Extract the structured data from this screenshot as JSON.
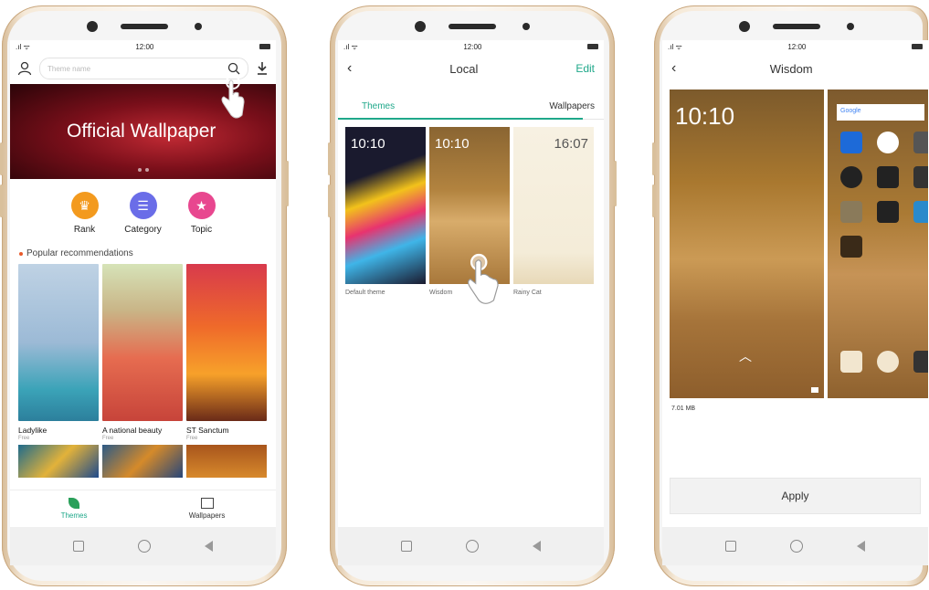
{
  "status": {
    "time": "12:00"
  },
  "screen1": {
    "search_placeholder": "Theme name",
    "banner_text": "Official Wallpaper",
    "categories": [
      {
        "label": "Rank",
        "icon": "crown-icon",
        "color": "#f39a1e"
      },
      {
        "label": "Category",
        "icon": "list-icon",
        "color": "#6a6de8"
      },
      {
        "label": "Topic",
        "icon": "star-icon",
        "color": "#e8478f"
      }
    ],
    "section_title": "Popular recommendations",
    "items": [
      {
        "name": "Ladylike",
        "price": "Free"
      },
      {
        "name": "A national beauty",
        "price": "Free"
      },
      {
        "name": "ST Sanctum",
        "price": "Free"
      }
    ],
    "tabs": [
      {
        "label": "Themes",
        "icon": "leaf-icon",
        "active": true
      },
      {
        "label": "Wallpapers",
        "icon": "image-icon",
        "active": false
      }
    ]
  },
  "screen2": {
    "title": "Local",
    "edit": "Edit",
    "tabs": [
      "Themes",
      "Wallpapers"
    ],
    "themes": [
      {
        "name": "Default theme",
        "clock": "10:10"
      },
      {
        "name": "Wisdom",
        "clock": "10:10"
      },
      {
        "name": "Rainy Cat",
        "clock": "16:07"
      }
    ]
  },
  "screen3": {
    "title": "Wisdom",
    "clock": "10:10",
    "search_label": "Google",
    "size": "7.01 MB",
    "apply": "Apply"
  },
  "colors": {
    "accent": "#1fa88a",
    "edit": "#1fa88a"
  }
}
